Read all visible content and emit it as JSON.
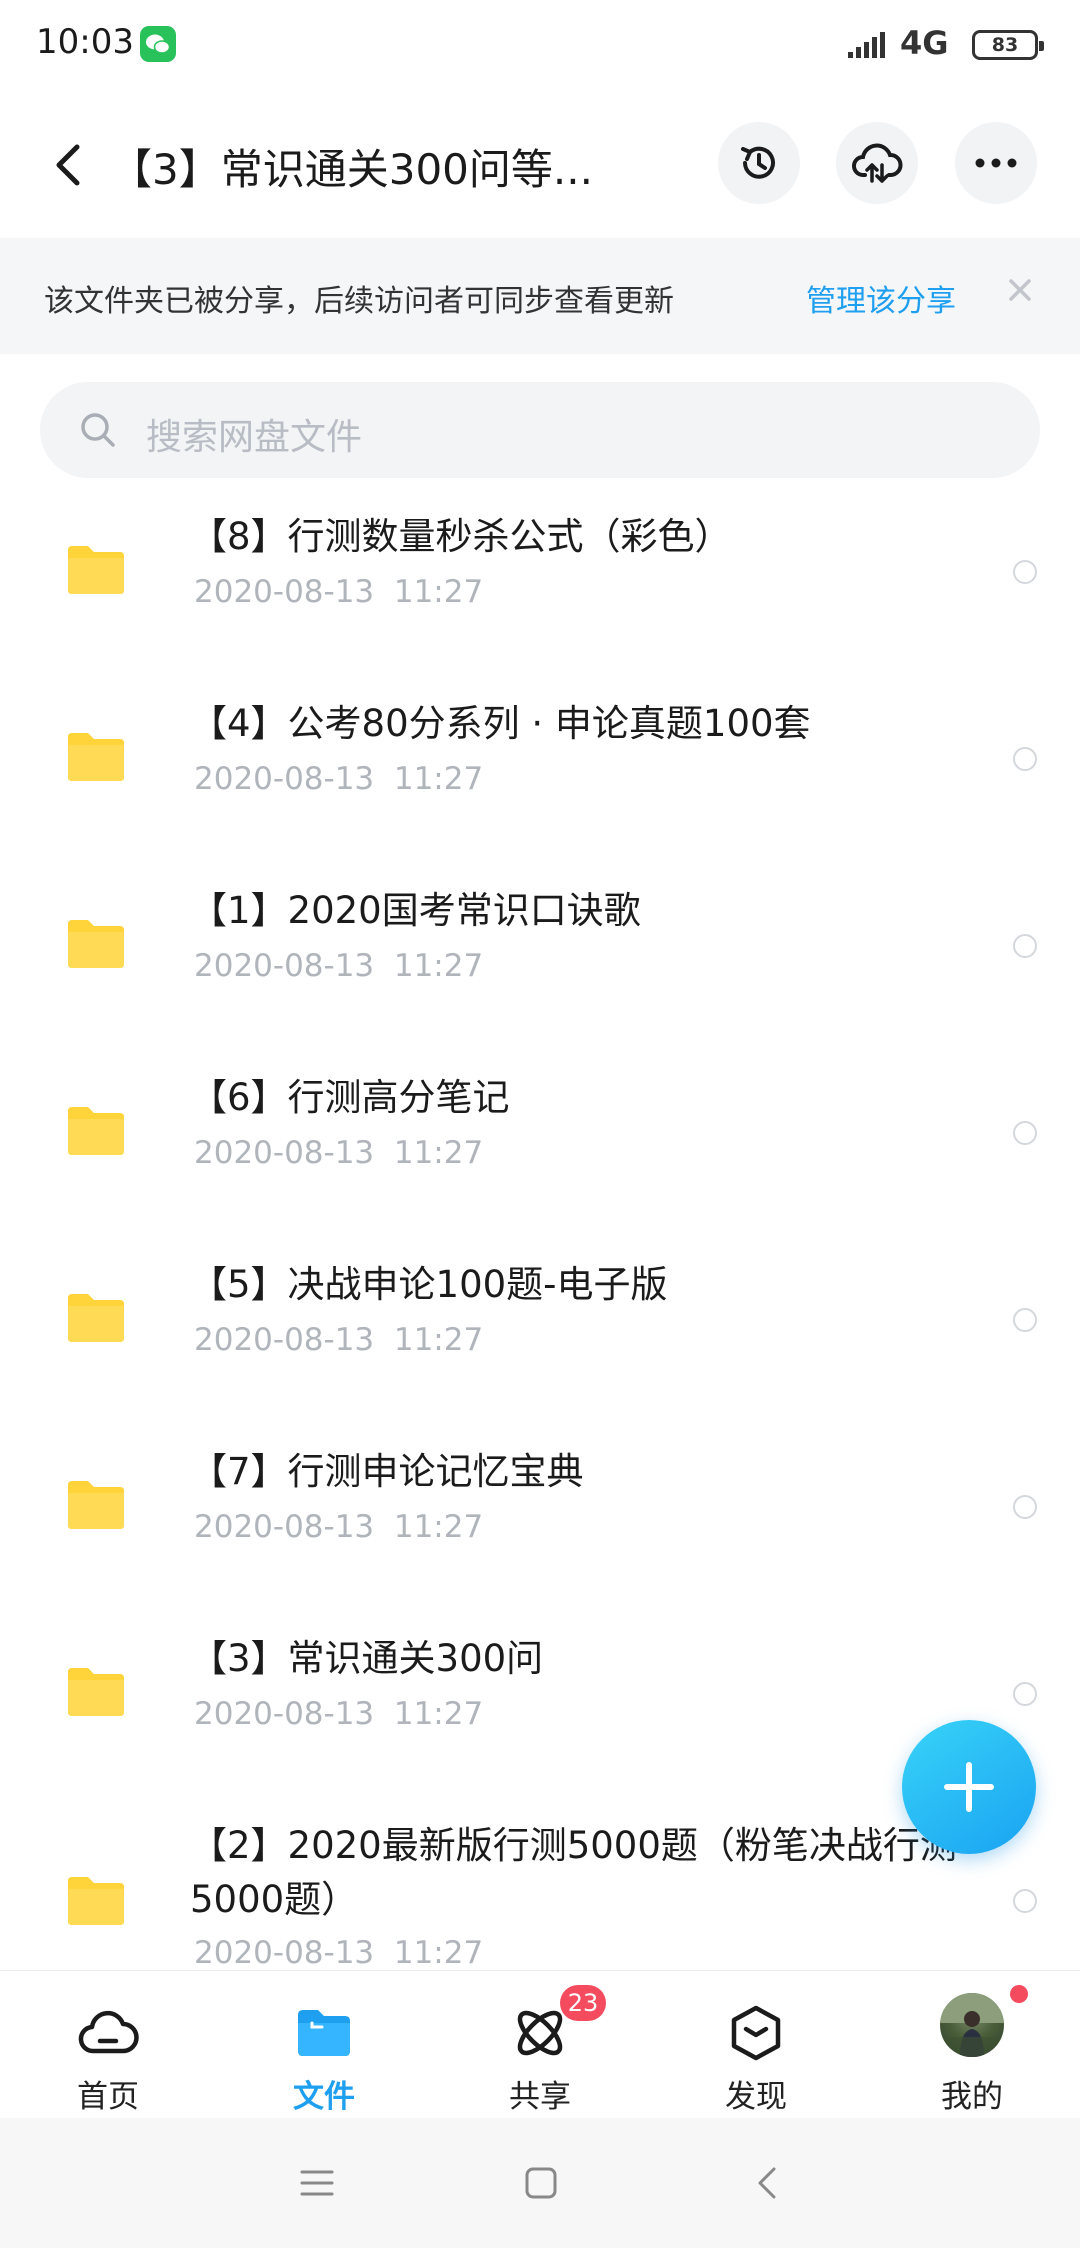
{
  "status_bar": {
    "time": "10:03",
    "network": "4G",
    "battery": "83"
  },
  "header": {
    "title": "【3】常识通关300问等..."
  },
  "share_banner": {
    "text": "该文件夹已被分享，后续访问者可同步查看更新",
    "manage_label": "管理该分享"
  },
  "search": {
    "placeholder": "搜索网盘文件"
  },
  "files": [
    {
      "name": "【8】行测数量秒杀公式（彩色）",
      "date": "2020-08-13  11:27"
    },
    {
      "name": "【4】公考80分系列 · 申论真题100套",
      "date": "2020-08-13  11:27"
    },
    {
      "name": "【1】2020国考常识口诀歌",
      "date": "2020-08-13  11:27"
    },
    {
      "name": "【6】行测高分笔记",
      "date": "2020-08-13  11:27"
    },
    {
      "name": "【5】决战申论100题-电子版",
      "date": "2020-08-13  11:27"
    },
    {
      "name": "【7】行测申论记忆宝典",
      "date": "2020-08-13  11:27"
    },
    {
      "name": "【3】常识通关300问",
      "date": "2020-08-13  11:27"
    },
    {
      "name": "【2】2020最新版行测5000题（粉笔决战行测5000题）",
      "date": "2020-08-13  11:27"
    }
  ],
  "bottom_nav": [
    {
      "label": "首页",
      "icon": "cloud-home-icon"
    },
    {
      "label": "文件",
      "icon": "folder-icon",
      "active": true
    },
    {
      "label": "共享",
      "icon": "atom-share-icon",
      "badge": "23"
    },
    {
      "label": "发现",
      "icon": "hexagon-discover-icon"
    },
    {
      "label": "我的",
      "icon": "avatar"
    }
  ],
  "colors": {
    "accent": "#1f9ff0",
    "folder": "#ffd43b",
    "badge": "#f44c5e"
  }
}
